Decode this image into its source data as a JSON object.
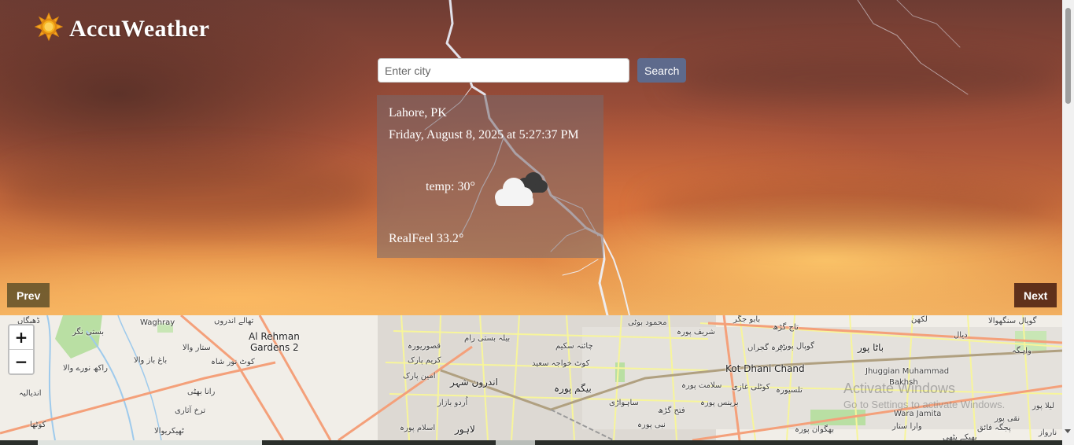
{
  "brand": {
    "name": "AccuWeather",
    "logo_icon": "sun-icon"
  },
  "search": {
    "placeholder": "Enter city",
    "value": "",
    "button_label": "Search"
  },
  "weather": {
    "location": "Lahore, PK",
    "datetime": "Friday, August 8, 2025 at 5:27:37 PM",
    "temp": "temp: 30°",
    "condition_icon": "cloud-icon",
    "realfeel": "RealFeel 33.2°"
  },
  "carousel": {
    "prev_label": "Prev",
    "next_label": "Next"
  },
  "map": {
    "zoom_in": "+",
    "zoom_out": "−",
    "labels": [
      "ڈھیگاں",
      "Waghray",
      "تھالے اندروں",
      "Al Rehman",
      "Gardens 2",
      "بستی نگر",
      "ستار والا",
      "باغ باز والا",
      "کوٹ نور شاہ",
      "راکھ نورے والا",
      "رانا بھٹی",
      "اندیالیہ",
      "ترخ آثاری",
      "کوٹھا",
      "ٹھیکریوالا",
      "بیلہ بستی رام",
      "قصوریورہ",
      "کریم پارک",
      "امین پارک",
      "اندرون شہر",
      "اُردو بازار",
      "اسلام پورہ",
      "لاہور",
      "چائنہ سکیم",
      "کوٹ خواجہ سعید",
      "بیگم پورہ",
      "ساہواڑی",
      "فتح گڑھ",
      "نبی پورہ",
      "محمود بوٹی",
      "شریف پورہ",
      "بابو جگر",
      "تاج گڑھ",
      "ڈیرہ گجراں",
      "Kot Dhani Chand",
      "سلامت پورہ",
      "کوٹلی غازی",
      "برینس پورہ",
      "تلسیورہ",
      "گوپال پورہ",
      "باٹا پور",
      "Jhuggian Muhammad",
      "Bakhsh",
      "لکھن",
      "گوپال سنگھوالا",
      "دیال",
      "واہگہ",
      "Wara Jamita",
      "وارا ستار",
      "بھگوان پورہ",
      "بھیکے پٹھی",
      "لیلا پور",
      "نقی پور",
      "پجگہ فائق",
      "نارواز",
      "Activate Windows",
      "Go to Settings to activate Windows."
    ]
  },
  "colors": {
    "search_button": "#5e6a8c",
    "card_bg": "rgba(120,105,110,0.55)",
    "map_road_major": "#f4a07a",
    "map_road_minor": "#f7f59b"
  }
}
